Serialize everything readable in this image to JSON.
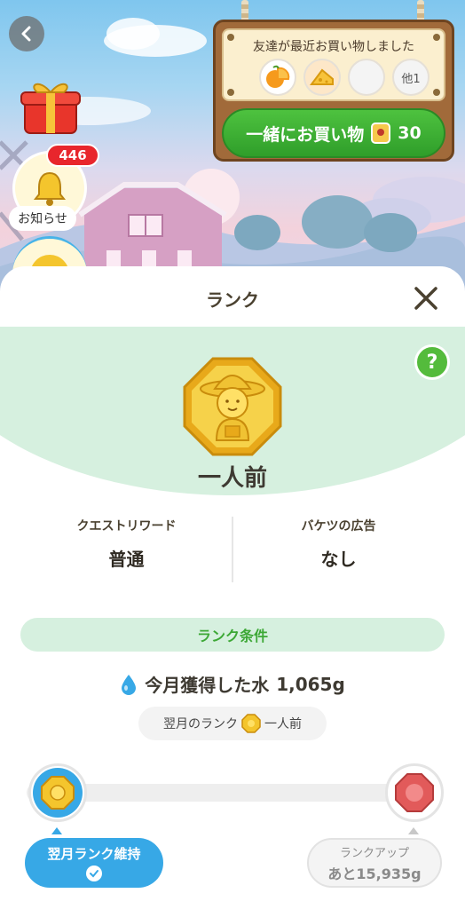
{
  "friends_board": {
    "title": "友達が最近お買い物しました",
    "friends": [
      {
        "icon": "orange-fruit-icon",
        "label": ""
      },
      {
        "icon": "cheese-icon",
        "label": ""
      },
      {
        "icon": "empty-slot",
        "label": ""
      },
      {
        "icon": "more-friends",
        "label": "他1"
      }
    ],
    "button_label": "一緒にお買い物",
    "button_cost": "30"
  },
  "notifications": {
    "badge_count": "446",
    "label": "お知らせ"
  },
  "sheet": {
    "title": "ランク",
    "help_label": "?",
    "rank_name": "一人前",
    "stats": [
      {
        "label": "クエストリワード",
        "value": "普通"
      },
      {
        "label": "バケツの広告",
        "value": "なし"
      }
    ],
    "conditions_title": "ランク条件",
    "water_label": "今月獲得した水",
    "water_value": "1,065g",
    "next_month_rank_label": "翌月のランク",
    "next_month_rank_name": "一人前",
    "keep_rank_label": "翌月ランク維持",
    "rank_up_label": "ランクアップ",
    "rank_up_remaining": "あと15,935g"
  },
  "colors": {
    "accent_green": "#3da836",
    "button_green": "#2f9e2a",
    "water_blue": "#37a8e6",
    "badge_red": "#e8262c",
    "medal_gold": "#f4c52d"
  }
}
